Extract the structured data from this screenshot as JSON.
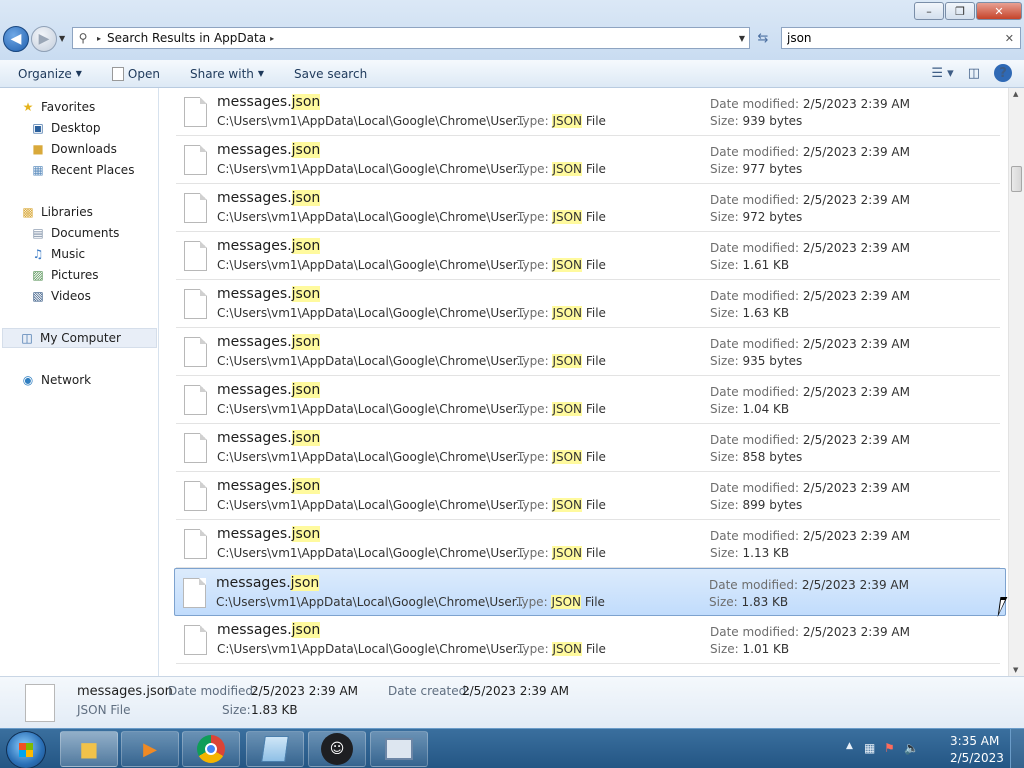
{
  "window": {
    "minimize": "–",
    "restore": "❐",
    "close": "✕"
  },
  "address": {
    "breadcrumb": "Search Results in AppData",
    "chevron": "▸"
  },
  "search": {
    "query": "json",
    "clear_icon": "✕"
  },
  "toolbar": {
    "organize": "Organize",
    "open": "Open",
    "share_with": "Share with",
    "save_search": "Save search"
  },
  "nav": {
    "favorites": "Favorites",
    "desktop": "Desktop",
    "downloads": "Downloads",
    "recent_places": "Recent Places",
    "libraries": "Libraries",
    "documents": "Documents",
    "music": "Music",
    "pictures": "Pictures",
    "videos": "Videos",
    "my_computer": "My Computer",
    "network": "Network"
  },
  "labels": {
    "type": "Type:",
    "date_modified": "Date modified:",
    "size": "Size:",
    "date_created": "Date created:"
  },
  "results": [
    {
      "name": "messages.",
      "ext": "json",
      "path": "C:\\Users\\vm1\\AppData\\Local\\Google\\Chrome\\User...",
      "type_hl": "JSON",
      "type_rest": " File",
      "date": "2/5/2023 2:39 AM",
      "size": "939 bytes"
    },
    {
      "name": "messages.",
      "ext": "json",
      "path": "C:\\Users\\vm1\\AppData\\Local\\Google\\Chrome\\User...",
      "type_hl": "JSON",
      "type_rest": " File",
      "date": "2/5/2023 2:39 AM",
      "size": "977 bytes"
    },
    {
      "name": "messages.",
      "ext": "json",
      "path": "C:\\Users\\vm1\\AppData\\Local\\Google\\Chrome\\User...",
      "type_hl": "JSON",
      "type_rest": " File",
      "date": "2/5/2023 2:39 AM",
      "size": "972 bytes"
    },
    {
      "name": "messages.",
      "ext": "json",
      "path": "C:\\Users\\vm1\\AppData\\Local\\Google\\Chrome\\User...",
      "type_hl": "JSON",
      "type_rest": " File",
      "date": "2/5/2023 2:39 AM",
      "size": "1.61 KB"
    },
    {
      "name": "messages.",
      "ext": "json",
      "path": "C:\\Users\\vm1\\AppData\\Local\\Google\\Chrome\\User...",
      "type_hl": "JSON",
      "type_rest": " File",
      "date": "2/5/2023 2:39 AM",
      "size": "1.63 KB"
    },
    {
      "name": "messages.",
      "ext": "json",
      "path": "C:\\Users\\vm1\\AppData\\Local\\Google\\Chrome\\User...",
      "type_hl": "JSON",
      "type_rest": " File",
      "date": "2/5/2023 2:39 AM",
      "size": "935 bytes"
    },
    {
      "name": "messages.",
      "ext": "json",
      "path": "C:\\Users\\vm1\\AppData\\Local\\Google\\Chrome\\User...",
      "type_hl": "JSON",
      "type_rest": " File",
      "date": "2/5/2023 2:39 AM",
      "size": "1.04 KB"
    },
    {
      "name": "messages.",
      "ext": "json",
      "path": "C:\\Users\\vm1\\AppData\\Local\\Google\\Chrome\\User...",
      "type_hl": "JSON",
      "type_rest": " File",
      "date": "2/5/2023 2:39 AM",
      "size": "858 bytes"
    },
    {
      "name": "messages.",
      "ext": "json",
      "path": "C:\\Users\\vm1\\AppData\\Local\\Google\\Chrome\\User...",
      "type_hl": "JSON",
      "type_rest": " File",
      "date": "2/5/2023 2:39 AM",
      "size": "899 bytes"
    },
    {
      "name": "messages.",
      "ext": "json",
      "path": "C:\\Users\\vm1\\AppData\\Local\\Google\\Chrome\\User...",
      "type_hl": "JSON",
      "type_rest": " File",
      "date": "2/5/2023 2:39 AM",
      "size": "1.13 KB"
    },
    {
      "name": "messages.",
      "ext": "json",
      "path": "C:\\Users\\vm1\\AppData\\Local\\Google\\Chrome\\User...",
      "type_hl": "JSON",
      "type_rest": " File",
      "date": "2/5/2023 2:39 AM",
      "size": "1.83 KB",
      "selected": true
    },
    {
      "name": "messages.",
      "ext": "json",
      "path": "C:\\Users\\vm1\\AppData\\Local\\Google\\Chrome\\User...",
      "type_hl": "JSON",
      "type_rest": " File",
      "date": "2/5/2023 2:39 AM",
      "size": "1.01 KB"
    }
  ],
  "details": {
    "name": "messages.json",
    "type": "JSON File",
    "date_modified": "2/5/2023 2:39 AM",
    "date_created": "2/5/2023 2:39 AM",
    "size": "1.83 KB"
  },
  "clock": {
    "time": "3:35 AM",
    "date": "2/5/2023"
  },
  "taskbar_apps": [
    "file-explorer",
    "media-player",
    "chrome",
    "notepad",
    "discord",
    "remote-desktop"
  ]
}
